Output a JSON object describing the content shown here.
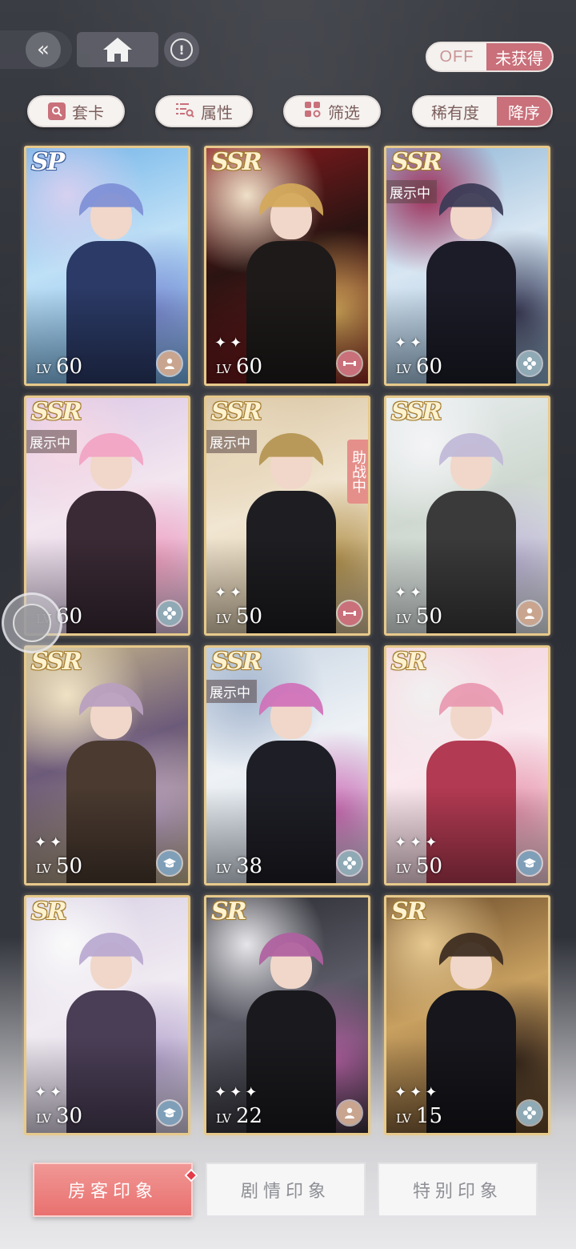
{
  "header": {
    "back_glyph": "«",
    "info_glyph": "!",
    "toggle": {
      "off_label": "OFF",
      "state_label": "未获得"
    }
  },
  "filters": {
    "set_label": "套卡",
    "attr_label": "属性",
    "filter_label": "筛选",
    "sort_label": "稀有度",
    "order_label": "降序"
  },
  "cards": [
    {
      "rarity": "SP",
      "showing": "",
      "assist": "",
      "stars": 0,
      "lv_label": "LV",
      "level": "60",
      "type_icon": "person-icon",
      "badge_color": "#c9a58f",
      "palette": [
        "#6fb3e8",
        "#bfe0f6",
        "#7e8fd6",
        "#2b3a66",
        "#d6d0f0"
      ]
    },
    {
      "rarity": "SSR",
      "showing": "",
      "assist": "",
      "stars": 2,
      "lv_label": "LV",
      "level": "60",
      "type_icon": "dumbbell-icon",
      "badge_color": "#c9707a",
      "palette": [
        "#8a1a1e",
        "#2a1412",
        "#d4a85a",
        "#1e1a1a",
        "#f0e0c8"
      ]
    },
    {
      "rarity": "SSR",
      "showing": "展示中",
      "assist": "",
      "stars": 2,
      "lv_label": "LV",
      "level": "60",
      "type_icon": "flower-icon",
      "badge_color": "#8fa9b5",
      "palette": [
        "#8fb6d6",
        "#d8e6f2",
        "#3a3a55",
        "#1c1c28",
        "#a0305a"
      ]
    },
    {
      "rarity": "SSR",
      "showing": "展示中",
      "assist": "",
      "stars": 0,
      "lv_label": "LV",
      "level": "60",
      "type_icon": "flower-icon",
      "badge_color": "#8fa9b5",
      "palette": [
        "#d9c6e6",
        "#f3e6ef",
        "#f2a3c3",
        "#3a2a35",
        "#f6d8e4"
      ]
    },
    {
      "rarity": "SSR",
      "showing": "展示中",
      "assist": "助战中",
      "stars": 2,
      "lv_label": "LV",
      "level": "50",
      "type_icon": "dumbbell-icon",
      "badge_color": "#c9707a",
      "palette": [
        "#d8c3a0",
        "#f1e6d2",
        "#b49450",
        "#1e1e22",
        "#e8d8bc"
      ]
    },
    {
      "rarity": "SSR",
      "showing": "",
      "assist": "",
      "stars": 2,
      "lv_label": "LV",
      "level": "50",
      "type_icon": "person-icon",
      "badge_color": "#c9a58f",
      "palette": [
        "#e8eef0",
        "#cfd8d0",
        "#c0b8d8",
        "#3a3a3a",
        "#f4f4f6"
      ]
    },
    {
      "rarity": "SSR",
      "showing": "",
      "assist": "",
      "stars": 2,
      "lv_label": "LV",
      "level": "50",
      "type_icon": "hat-icon",
      "badge_color": "#7f9fb8",
      "palette": [
        "#c8b88a",
        "#6c5a7a",
        "#b8a0c0",
        "#4a3a30",
        "#efe2c4"
      ]
    },
    {
      "rarity": "SSR",
      "showing": "展示中",
      "assist": "",
      "stars": 0,
      "lv_label": "LV",
      "level": "38",
      "type_icon": "flower-icon",
      "badge_color": "#8fa9b5",
      "palette": [
        "#c8d4e2",
        "#eef2f6",
        "#d070b8",
        "#1e1e26",
        "#a8b8d0"
      ]
    },
    {
      "rarity": "SR",
      "showing": "",
      "assist": "",
      "stars": 3,
      "lv_label": "LV",
      "level": "50",
      "type_icon": "hat-icon",
      "badge_color": "#7f9fb8",
      "palette": [
        "#f4d2dc",
        "#f9e8ee",
        "#e898b0",
        "#b23a52",
        "#f2f0f0"
      ]
    },
    {
      "rarity": "SR",
      "showing": "",
      "assist": "",
      "stars": 2,
      "lv_label": "LV",
      "level": "30",
      "type_icon": "hat-icon",
      "badge_color": "#7f9fb8",
      "palette": [
        "#d8d0e4",
        "#f0eaf2",
        "#b8a8d0",
        "#4a3e56",
        "#fafafa"
      ]
    },
    {
      "rarity": "SR",
      "showing": "",
      "assist": "",
      "stars": 3,
      "lv_label": "LV",
      "level": "22",
      "type_icon": "person-icon",
      "badge_color": "#c9a58f",
      "palette": [
        "#2a2a30",
        "#5a5a66",
        "#b060a0",
        "#1a1a1e",
        "#e6e6ea"
      ]
    },
    {
      "rarity": "SR",
      "showing": "",
      "assist": "",
      "stars": 3,
      "lv_label": "LV",
      "level": "15",
      "type_icon": "flower-icon",
      "badge_color": "#8fa9b5",
      "palette": [
        "#6a4a2a",
        "#c8a060",
        "#3a2a1e",
        "#16161c",
        "#e6c890"
      ]
    }
  ],
  "tabs": {
    "guest": "房客印象",
    "story": "剧情印象",
    "special": "特别印象"
  }
}
